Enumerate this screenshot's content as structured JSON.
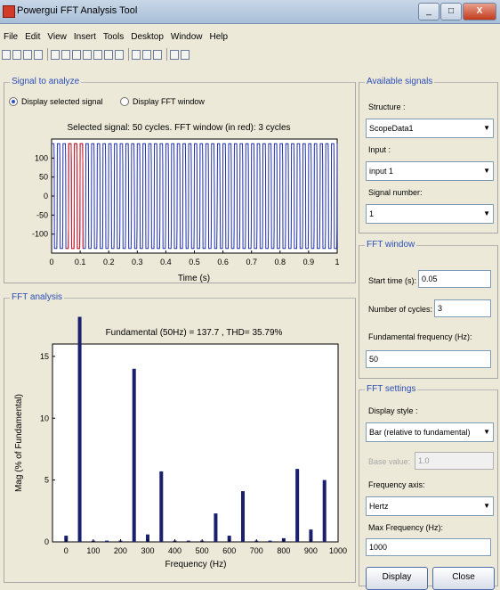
{
  "window": {
    "title": "Powergui FFT Analysis Tool",
    "minimize": "_",
    "maximize": "□",
    "close": "X"
  },
  "menu": [
    "File",
    "Edit",
    "View",
    "Insert",
    "Tools",
    "Desktop",
    "Window",
    "Help"
  ],
  "signal_panel": {
    "title": "Signal to analyze",
    "radio_selected": "Display selected signal",
    "radio_fft": "Display FFT window",
    "plot_title": "Selected signal: 50 cycles. FFT window (in red): 3 cycles",
    "xlabel": "Time (s)",
    "x_ticks": [
      "0",
      "0.1",
      "0.2",
      "0.3",
      "0.4",
      "0.5",
      "0.6",
      "0.7",
      "0.8",
      "0.9",
      "1"
    ],
    "y_ticks": [
      "100",
      "50",
      "0",
      "-50",
      "-100"
    ]
  },
  "fft_panel": {
    "title": "FFT analysis",
    "plot_title": "Fundamental (50Hz) = 137.7 , THD= 35.79%",
    "xlabel": "Frequency (Hz)",
    "ylabel": "Mag (% of Fundamental)",
    "x_ticks": [
      "0",
      "100",
      "200",
      "300",
      "400",
      "500",
      "600",
      "700",
      "800",
      "900",
      "1000"
    ],
    "y_ticks": [
      "15",
      "10",
      "5",
      "0"
    ]
  },
  "chart_data": [
    {
      "type": "line",
      "title": "Selected signal: 50 cycles. FFT window (in red): 3 cycles",
      "xlabel": "Time (s)",
      "ylabel": "",
      "xlim": [
        0,
        1
      ],
      "ylim": [
        -150,
        150
      ],
      "cycles": 50,
      "frequency_hz": 50,
      "amplitude_peak": 137.7,
      "fft_window_cycles": 3,
      "fft_window_start_s": 0.05,
      "series": [
        {
          "name": "signal",
          "color": "#1f2fb0"
        },
        {
          "name": "FFT window",
          "color": "#e01a1a"
        }
      ]
    },
    {
      "type": "bar",
      "title": "Fundamental (50Hz) = 137.7 , THD= 35.79%",
      "xlabel": "Frequency (Hz)",
      "ylabel": "Mag (% of Fundamental)",
      "xlim": [
        -50,
        1000
      ],
      "ylim": [
        0,
        16
      ],
      "x": [
        0,
        50,
        100,
        150,
        200,
        250,
        300,
        350,
        400,
        450,
        500,
        550,
        600,
        650,
        700,
        750,
        800,
        850,
        900,
        950
      ],
      "values": [
        0.5,
        18.2,
        0.1,
        0.1,
        0.1,
        14.0,
        0.6,
        5.7,
        0.1,
        0.1,
        0.1,
        2.3,
        0.5,
        4.1,
        0.1,
        0.1,
        0.3,
        5.9,
        1.0,
        5.0
      ],
      "color": "#1a1f6e"
    }
  ],
  "available_signals": {
    "title": "Available signals",
    "structure_label": "Structure :",
    "structure_value": "ScopeData1",
    "input_label": "Input :",
    "input_value": "input 1",
    "signal_number_label": "Signal number:",
    "signal_number_value": "1"
  },
  "fft_window": {
    "title": "FFT window",
    "start_time_label": "Start time (s):",
    "start_time_value": "0.05",
    "cycles_label": "Number of cycles:",
    "cycles_value": "3",
    "fund_freq_label": "Fundamental frequency (Hz):",
    "fund_freq_value": "50"
  },
  "fft_settings": {
    "title": "FFT settings",
    "display_style_label": "Display style :",
    "display_style_value": "Bar (relative to fundamental)",
    "base_value_label": "Base value:",
    "base_value_value": "1.0",
    "freq_axis_label": "Frequency axis:",
    "freq_axis_value": "Hertz",
    "max_freq_label": "Max Frequency (Hz):",
    "max_freq_value": "1000"
  },
  "buttons": {
    "display": "Display",
    "close": "Close"
  }
}
